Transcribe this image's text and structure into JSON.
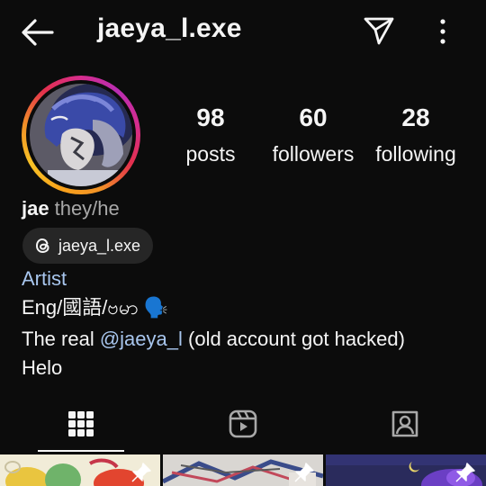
{
  "header": {
    "username": "jaeya_l.exe"
  },
  "stats": [
    {
      "value": "98",
      "label": "posts"
    },
    {
      "value": "60",
      "label": "followers"
    },
    {
      "value": "28",
      "label": "following"
    }
  ],
  "profile": {
    "name": "jae",
    "pronouns": "they/he",
    "threads_handle": "jaeya_l.exe",
    "category": "Artist",
    "bio_line1": "Eng/國語/ဗမာ 🗣️",
    "bio_line2_prefix": "The real ",
    "bio_line2_mention": "@jaeya_l",
    "bio_line2_suffix": " (old account got hacked)",
    "bio_line3": "Helo"
  },
  "tabs": [
    {
      "icon": "grid-icon",
      "selected": true
    },
    {
      "icon": "reels-icon",
      "selected": false
    },
    {
      "icon": "tagged-icon",
      "selected": false
    }
  ],
  "grid_posts": [
    {
      "pinned": true,
      "icon": "pin-icon"
    },
    {
      "pinned": true,
      "icon": "pin-icon"
    },
    {
      "pinned": true,
      "icon": "pin-icon"
    }
  ],
  "colors": {
    "background": "#0c0c0c",
    "link": "#a8c6ee",
    "secondary_text": "#a8a8a8",
    "chip": "#262626",
    "story_ring": [
      "#f9a21b",
      "#e3304d",
      "#b92db2"
    ]
  }
}
